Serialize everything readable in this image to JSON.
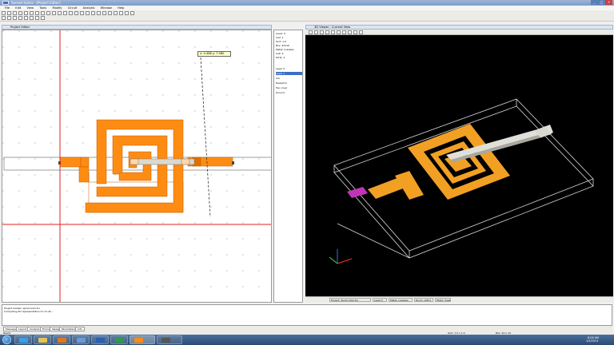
{
  "window": {
    "title": "Sonnet Suites - [Project Editor]",
    "app_icon": "sonnet-app-icon"
  },
  "menu": [
    "File",
    "Edit",
    "View",
    "Tools",
    "Modify",
    "Circuit",
    "Analysis",
    "Window",
    "Help"
  ],
  "editor": {
    "title": "Project Editor",
    "coord_readout": "x: 4.486  y: 7.960"
  },
  "side_panel": {
    "lines": [
      "Level: 0",
      "Cell: 1",
      "Grid: 1.0",
      "Box: 20x10",
      "Metal: Lossless",
      "Sub: 2",
      "Ports: 2",
      "Layer 0",
      "Layer 1",
      "Via",
      "Dielectric",
      "Top cover",
      "Ground"
    ]
  },
  "view3d": {
    "title": "3D Viewer - Current View",
    "status": [
      "Project: Spiral inductor",
      "Level 0",
      "Metal: Lossless",
      "Zoom: 100%",
      "Mode: View"
    ]
  },
  "log": {
    "lines": [
      "Project loaded: spiral inductor",
      "Computing 3D representation of circuit..."
    ],
    "tabs": [
      "Messages",
      "Layout",
      "Analysis",
      "Errors",
      "Sweep",
      "Parameters",
      "Info"
    ]
  },
  "status_bar": [
    "Ready",
    "Grid: 1.0 x 1.0",
    "Box: 20 x 10"
  ],
  "taskbar": {
    "time": "8:06 AM",
    "date": "1/3/2013"
  },
  "colors": {
    "metal": "#ff8c12",
    "metal3d": "#f2a024",
    "bridge": "#d9d8d2",
    "port3d": "#c035b6",
    "ref_line": "#e02020"
  }
}
